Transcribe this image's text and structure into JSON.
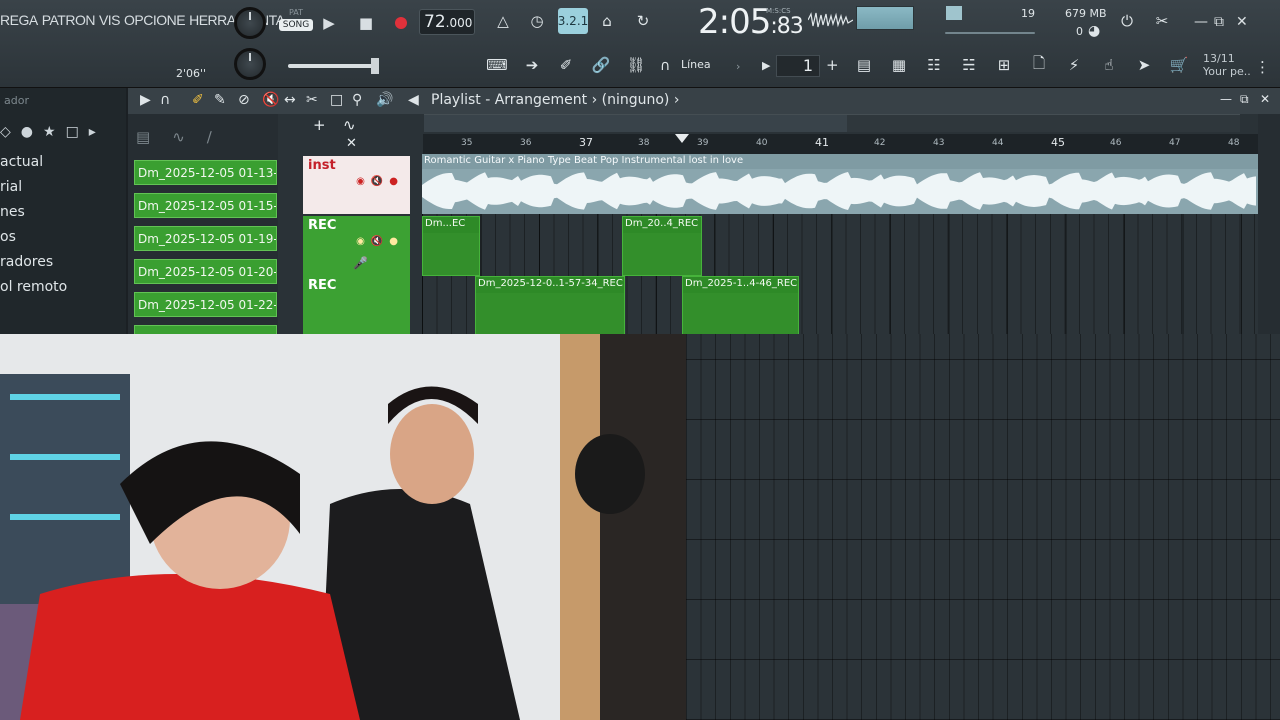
{
  "menu": {
    "items": [
      "REGA",
      "PATRON",
      "VIS",
      "OPCIONE",
      "HERRAMIENTA"
    ]
  },
  "transport": {
    "pat_label": "PAT",
    "song_label": "SONG",
    "tempo": "72",
    "tempo_decimals": ".000",
    "master_time": "2'06''"
  },
  "timer": {
    "main": "2:05",
    "sub": ":83",
    "unit_label": "M:S:CS"
  },
  "status": {
    "cpu": "19",
    "memory": "679 MB",
    "polyphony": "0"
  },
  "snap": {
    "label": "Línea",
    "step": "1",
    "step_plus": "+"
  },
  "hint": {
    "line1": "13/11",
    "line2": "Your pe.."
  },
  "browser": {
    "title": "ador",
    "items": [
      "actual",
      "rial",
      "nes",
      "os",
      "radores",
      "ol remoto"
    ]
  },
  "playlist": {
    "title": "Playlist - Arrangement",
    "pattern": "(ninguno)",
    "clip_list": [
      "Dm_2025-12-05 01-13-...",
      "Dm_2025-12-05 01-15-...",
      "Dm_2025-12-05 01-19-...",
      "Dm_2025-12-05 01-20-...",
      "Dm_2025-12-05 01-22-..."
    ],
    "tracks": [
      {
        "name": "inst"
      },
      {
        "name": "REC"
      },
      {
        "name": "REC"
      }
    ],
    "ruler": [
      "35",
      "36",
      "37",
      "38",
      "39",
      "40",
      "41",
      "42",
      "43",
      "44",
      "45",
      "46",
      "47",
      "48"
    ],
    "main_clip": "Romantic Guitar x Piano Type Beat  Pop Instrumental  lost in love",
    "rec_clips": [
      "Dm...EC",
      "Dm_20..4_REC",
      "Dm_2025-12-0..1-57-34_REC",
      "Dm_2025-1..4-46_REC"
    ]
  },
  "colors": {
    "accent": "#9bd0dd",
    "track_green": "#3ca133",
    "record_red": "#e0313b"
  }
}
